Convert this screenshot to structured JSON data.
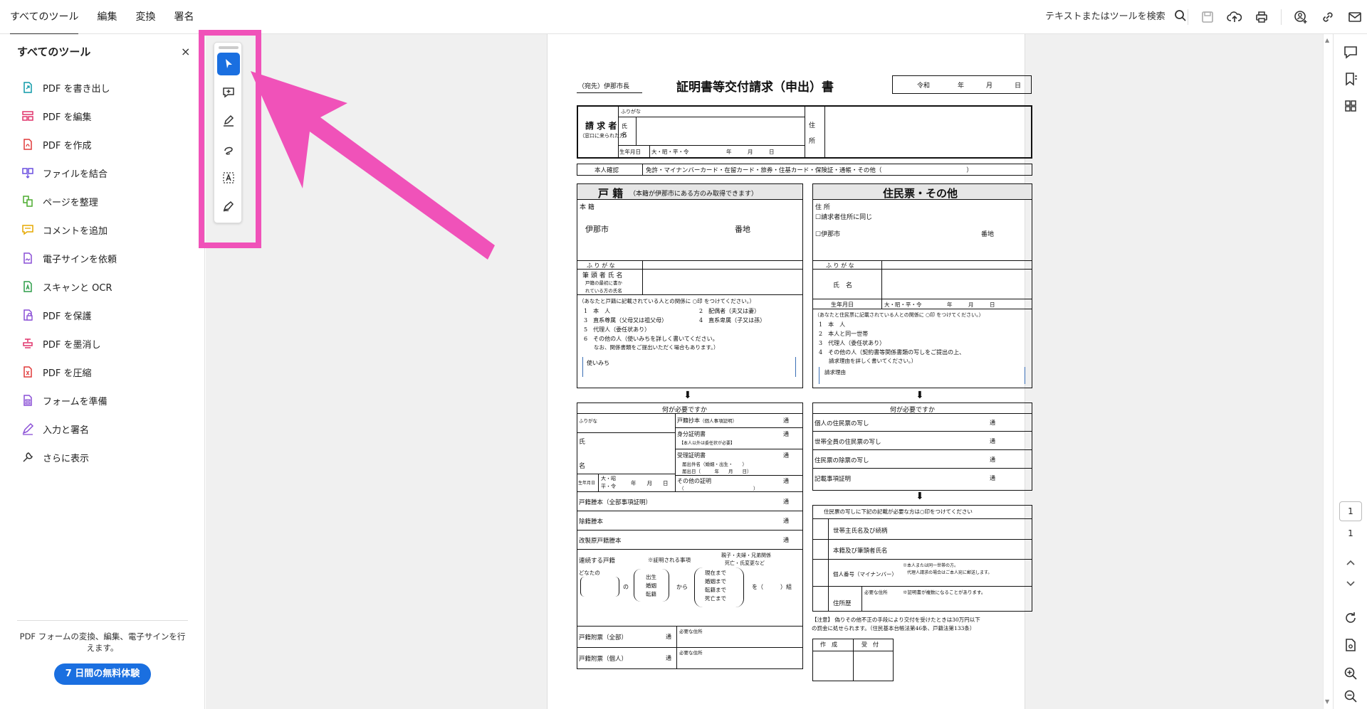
{
  "menu": {
    "items": [
      "すべてのツール",
      "編集",
      "変換",
      "署名"
    ],
    "active": 0
  },
  "search": {
    "label": "テキストまたはツールを検索"
  },
  "sidebar": {
    "title": "すべてのツール",
    "close": "×",
    "tools": [
      {
        "label": "PDF を書き出し",
        "icon": "export-pdf-icon",
        "color": "#0f9aa8"
      },
      {
        "label": "PDF を編集",
        "icon": "edit-pdf-icon",
        "color": "#e0336b"
      },
      {
        "label": "PDF を作成",
        "icon": "create-pdf-icon",
        "color": "#e03a3a"
      },
      {
        "label": "ファイルを結合",
        "icon": "combine-files-icon",
        "color": "#6a4fe0"
      },
      {
        "label": "ページを整理",
        "icon": "organize-pages-icon",
        "color": "#4cab2f"
      },
      {
        "label": "コメントを追加",
        "icon": "add-comment-icon",
        "color": "#e6a800"
      },
      {
        "label": "電子サインを依頼",
        "icon": "request-esign-icon",
        "color": "#8a4fd6"
      },
      {
        "label": "スキャンと OCR",
        "icon": "scan-ocr-icon",
        "color": "#2e9e4a"
      },
      {
        "label": "PDF を保護",
        "icon": "protect-pdf-icon",
        "color": "#8a4fd6"
      },
      {
        "label": "PDF を墨消し",
        "icon": "redact-pdf-icon",
        "color": "#e0336b"
      },
      {
        "label": "PDF を圧縮",
        "icon": "compress-pdf-icon",
        "color": "#e03a3a"
      },
      {
        "label": "フォームを準備",
        "icon": "prepare-form-icon",
        "color": "#8a4fd6"
      },
      {
        "label": "入力と署名",
        "icon": "fill-sign-icon",
        "color": "#8a4fd6"
      },
      {
        "label": "さらに表示",
        "icon": "more-tools-icon",
        "color": "#333333"
      }
    ],
    "footer_text": "PDF フォームの変換、編集、電子サインを行えます。",
    "trial_button": "7 日間の無料体験"
  },
  "page_nav": {
    "current": "1",
    "total": "1"
  },
  "colors": {
    "accent": "#1a6fe0",
    "highlight": "#f052b9"
  },
  "document": {
    "addressee": "（宛先）伊那市長",
    "title": "証明書等交付請求（申出）書",
    "date": {
      "era": "令和",
      "year": "年",
      "month": "月",
      "day": "日"
    },
    "requester": {
      "label": "請 求 者",
      "sublabel": "（窓口に来られた方）",
      "furigana": "ふりがな",
      "name": "氏 名",
      "birth": "生年月日",
      "era": "大・昭・平・令",
      "ymd": "年　　　月　　　日",
      "address": "住 所"
    },
    "id_check": {
      "label": "本人確認",
      "options": "免許・マイナンバーカード・在留カード・旅券・住基カード・保険証・通帳・その他（　　　　　　　　　　　　　　）"
    },
    "koseki": {
      "header": "戸 籍",
      "header_note": "（本籍が伊那市にある方のみ取得できます）",
      "honseki": "本 籍",
      "city": "伊那市",
      "banchi": "番地",
      "furigana": "ふ り が な",
      "head_name": "筆 頭 者 氏 名",
      "head_note1": "戸籍の最初に書か",
      "head_note2": "れている方の氏名",
      "rel_note": "（あなたと戸籍に記載されている人との関係に ○印 をつけてください。）",
      "rel1": "1　本　人",
      "rel2": "2　配偶者（夫又は妻）",
      "rel3": "3　直系尊属（父母又は祖父母）",
      "rel4": "4　直系卑属（子又は孫）",
      "rel5": "5　代理人（委任状あり）",
      "rel6": "6　その他の人（使いみちを詳しく書いてください。",
      "rel6b": "なお、関係書類をご提出いただく場合もあります。）",
      "purpose": "使いみち"
    },
    "juminhyo": {
      "header": "住民票・その他",
      "address": "住 所",
      "same": "☐請求者住所に同じ",
      "city": "☐伊那市",
      "banchi": "番地",
      "furigana": "ふ り が な",
      "name": "氏　名",
      "birth": "生年月日",
      "era": "大・昭・平・令",
      "ymd": "年　　　月　　　日",
      "rel_note": "（あなたと住民票に記載されている人との関係に ○印 をつけてください。）",
      "rel1": "1　本　人",
      "rel2": "2　本人と同一世帯",
      "rel3": "3　代理人（委任状あり）",
      "rel4": "4　その他の人（契約書等関係書類の写しをご提出の上、",
      "rel4b": "請求理由を詳しく書いてください。）",
      "reason": "請求理由"
    },
    "needed": "何が必要ですか",
    "koseki_items": {
      "furigana": "ふりがな",
      "shi": "氏",
      "mei": "名",
      "birth": "生年月日",
      "era1": "大・昭",
      "era2": "平・令",
      "ymd": "年　　月　　日",
      "shohon": "戸籍抄本",
      "shohon_note": "（個人事項証明）",
      "mibun": "身分証明書",
      "mibun_note": "【本人以外は委任状が必要】",
      "juri": "受理証明書",
      "juri_n1": "届出件名（婚姻・出生・　　）",
      "juri_n2": "届出日（　　　年　　月　　日）",
      "other": "その他の証明",
      "other_b": "（　　　　　　　　　　　　　　　）",
      "tohon": "戸籍謄本（全部事項証明）",
      "joseki": "除籍謄本",
      "kaisei": "改製原戸籍謄本",
      "renzoku": "連続する戸籍",
      "renzoku_note": "※証明される事項",
      "renzoku_r1": "親子・夫婦・兄弟関係",
      "renzoku_r2": "死亡・氏変更など",
      "donata": "どなたの",
      "no": "の",
      "ev1": "出生",
      "ev2": "婚姻",
      "ev3": "転籍",
      "kara": "から",
      "to1": "現在まで",
      "to2": "婚姻まで",
      "to3": "転籍まで",
      "to4": "死亡まで",
      "wo": "を（　　　）組",
      "fuhyo_all": "戸籍附票（全部）",
      "fuhyo_ind": "戸籍附票（個人）",
      "needed_addr": "必要な住所",
      "tsu": "通"
    },
    "jumin_items": {
      "item1": "個人の住民票の写し",
      "item2": "世帯全員の住民票の写し",
      "item3": "住民票の除票の写し",
      "item4": "記載事項証明",
      "tsu": "通",
      "note": "住民票の写しに下記の記載が必要な方は○印をつけてください",
      "opt1": "世帯主氏名及び続柄",
      "opt2": "本籍及び筆頭者氏名",
      "opt3": "個人番号（マイナンバー）",
      "opt3_n1": "※本人または同一世帯の方。",
      "opt3_n2": "代理人請求の場合はご本人宛に郵送します。",
      "opt4": "住所歴",
      "opt4_n1": "必要な住所",
      "opt4_n2": "※証明書が複数になることがあります。"
    },
    "warning1": "【注意】 偽りその他不正の手段により交付を受けたときは30万円以下",
    "warning2": "の罰金に処せられます。（住民基本台帳法第46条、戸籍法第133条）",
    "stamp": {
      "a": "作　成",
      "b": "受　付"
    }
  }
}
